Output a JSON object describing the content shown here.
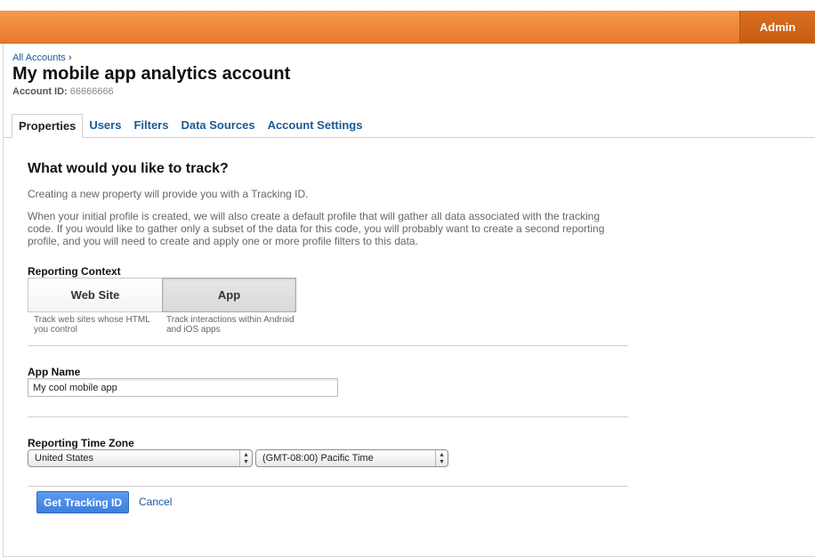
{
  "header": {
    "admin_label": "Admin"
  },
  "breadcrumb": {
    "link": "All Accounts",
    "separator": "›"
  },
  "page": {
    "title": "My mobile app analytics account",
    "account_id_label": "Account ID:",
    "account_id_value": "66666666"
  },
  "tabs": [
    {
      "label": "Properties",
      "active": true
    },
    {
      "label": "Users"
    },
    {
      "label": "Filters"
    },
    {
      "label": "Data Sources"
    },
    {
      "label": "Account Settings"
    }
  ],
  "form": {
    "question": "What would you like to track?",
    "intro1": "Creating a new property will provide you with a Tracking ID.",
    "intro2": "When your initial profile is created, we will also create a default profile that will gather all data associated with the tracking code. If you would like to gather only a subset of the data for this code, you will probably want to create a second reporting profile, and you will need to create and apply one or more profile filters to this data.",
    "reporting_context": {
      "label": "Reporting Context",
      "web": {
        "label": "Web Site",
        "desc": "Track web sites whose HTML you control"
      },
      "app": {
        "label": "App",
        "desc": "Track interactions within Android and iOS apps",
        "selected": true
      }
    },
    "app_name": {
      "label": "App Name",
      "value": "My cool mobile app"
    },
    "time_zone": {
      "label": "Reporting Time Zone",
      "country": "United States",
      "zone": "(GMT-08:00) Pacific Time"
    },
    "submit_label": "Get Tracking ID",
    "cancel_label": "Cancel"
  },
  "colors": {
    "accent_orange": "#e8782b",
    "link_blue": "#1a5a96",
    "primary_blue": "#3d7fe0"
  }
}
